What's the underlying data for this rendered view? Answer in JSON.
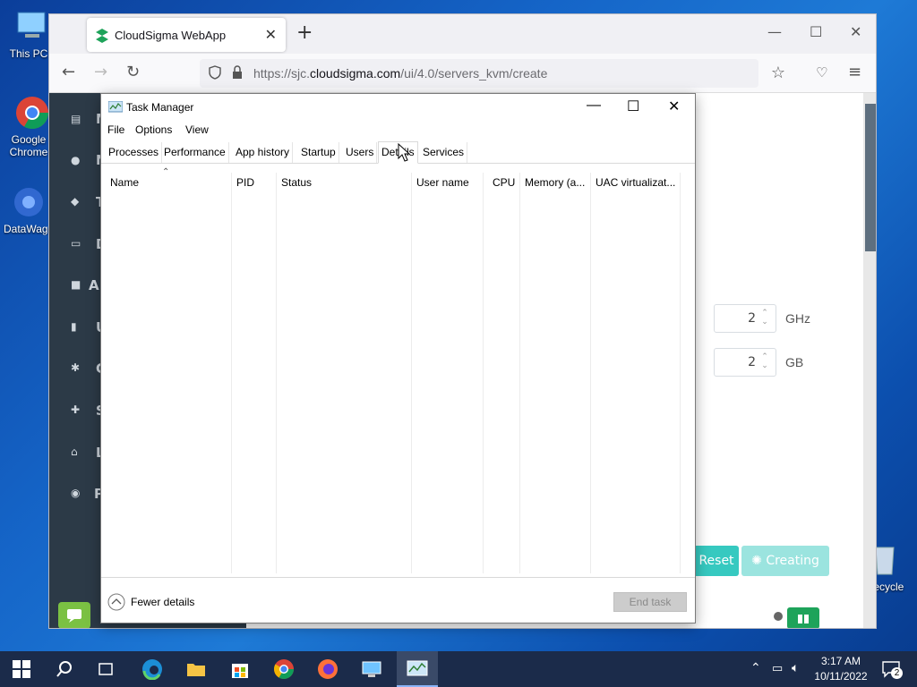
{
  "desktop": {
    "icons": [
      {
        "label": "This PC"
      },
      {
        "label": "Google Chrome"
      },
      {
        "label": "DataWagon"
      },
      {
        "label": "Recycle Bin"
      }
    ]
  },
  "browser": {
    "tab_title": "CloudSigma WebApp",
    "url_prefix": "https://sjc.",
    "url_domain": "cloudsigma.com",
    "url_path": "/ui/4.0/servers_kvm/create"
  },
  "webapp": {
    "sidebar_items": [
      "M",
      "N",
      "T",
      "D",
      "A",
      "U",
      "C",
      "S",
      "L",
      "P"
    ],
    "cpu": {
      "value": "2",
      "unit": "GHz"
    },
    "memory": {
      "value": "2",
      "unit": "GB"
    },
    "reset_label": "Reset",
    "create_label": "Creating"
  },
  "task_manager": {
    "title": "Task Manager",
    "menu": [
      "File",
      "Options",
      "View"
    ],
    "tabs": [
      "Processes",
      "Performance",
      "App history",
      "Startup",
      "Users",
      "Details",
      "Services"
    ],
    "active_tab": "Details",
    "columns": [
      "Name",
      "PID",
      "Status",
      "User name",
      "CPU",
      "Memory (a...",
      "UAC virtualizat..."
    ],
    "fewer_details": "Fewer details",
    "end_task": "End task"
  },
  "taskbar": {
    "time": "3:17 AM",
    "date": "10/11/2022",
    "notification_count": "2"
  }
}
